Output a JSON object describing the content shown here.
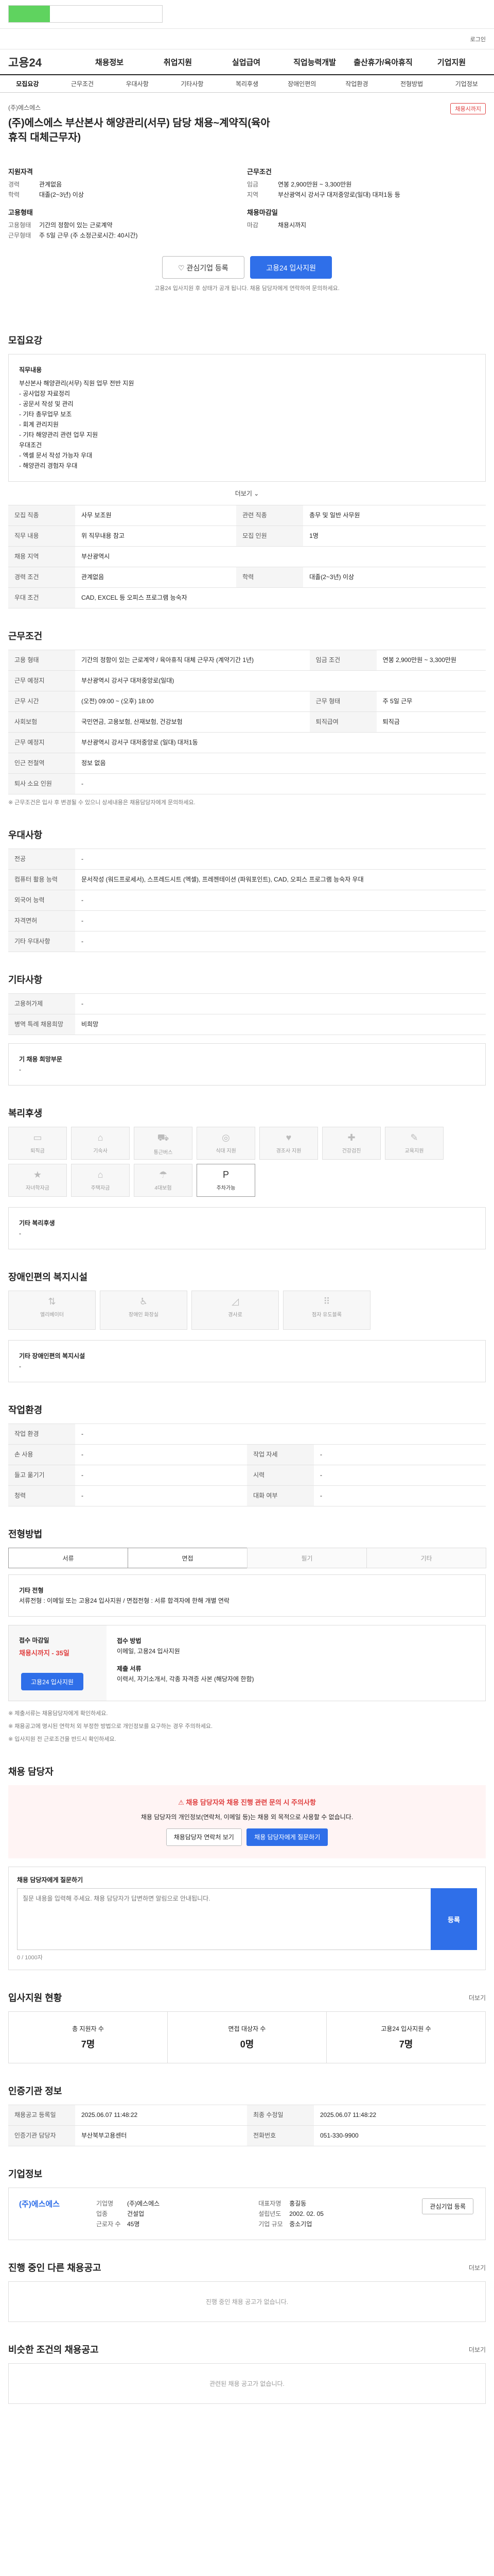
{
  "header": {
    "util": "로그인",
    "logo": "고용24",
    "gnb": [
      "채용정보",
      "취업지원",
      "실업급여",
      "직업능력개발",
      "출산휴가/육아휴직",
      "기업지원"
    ]
  },
  "tabs": [
    "모집요강",
    "근무조건",
    "우대사항",
    "기타사항",
    "복리후생",
    "장애인편의",
    "작업환경",
    "전형방법",
    "기업정보"
  ],
  "job": {
    "badge": "채용시까지",
    "company": "(주)에스에스",
    "title": "(주)에스에스 부산본사 해양관리(서무) 담당 채용~계약직(육아휴직 대체근무자)",
    "summary": {
      "qual_title": "지원자격",
      "qual": [
        [
          "경력",
          "관계없음"
        ],
        [
          "학력",
          "대졸(2~3년) 이상"
        ]
      ],
      "form_title": "고용형태",
      "form": [
        [
          "고용형태",
          "기간의 정함이 있는 근로계약"
        ],
        [
          "근무형태",
          "주 5일 근무 (주 소정근로시간: 40시간)"
        ]
      ],
      "cond_title": "근무조건",
      "cond": [
        [
          "임금",
          "연봉 2,900만원 ~ 3,300만원"
        ],
        [
          "지역",
          "부산광역시 강서구 대저중앙로(일대) 대저1동 등"
        ]
      ],
      "time_title": "채용마감일",
      "time": [
        [
          "마감",
          "채용시까지"
        ]
      ]
    },
    "btn_interest": "관심기업 등록",
    "btn_apply": "고용24 입사지원",
    "apply_note": "고용24 입사지원 후 상태가 공개 됩니다. 채용 담당자에게 연락하여 문의하세요."
  },
  "recruit": {
    "title": "모집요강",
    "duty_title": "직무내용",
    "duties": [
      "부산본사 해양관리(서무) 직원 업무 전반 지원",
      "- 공사업장 자료정리",
      "- 공문서 작성 및 관리",
      "- 기타 총무업무 보조",
      "- 회계 관리지원",
      "- 기타 해양관리 관련 업무 지원",
      "우대조건",
      "- 엑셀 문서 작성 가능자 우대",
      "- 해양관리 경험자 우대"
    ],
    "more": "더보기",
    "rows": [
      [
        "모집 직종",
        "사무 보조원",
        "관련 직종",
        "총무 및 일반 사무원"
      ],
      [
        "직무 내용",
        "위 직무내용 참고",
        "모집 인원",
        "1명"
      ],
      [
        "채용 지역",
        "부산광역시",
        "",
        ""
      ],
      [
        "경력 조건",
        "관계없음",
        "학력",
        "대졸(2~3년) 이상"
      ],
      [
        "우대 조건",
        "CAD, EXCEL 등 오피스 프로그램 능숙자",
        "",
        ""
      ]
    ]
  },
  "work": {
    "title": "근무조건",
    "rows": [
      [
        "고용 형태",
        "기간의 정함이 있는 근로계약 / 육아휴직 대체 근무자 (계약기간 1년)",
        "임금 조건",
        "연봉 2,900만원 ~ 3,300만원"
      ],
      [
        "근무 예정지",
        "부산광역시 강서구 대저중앙로(일대)",
        "",
        ""
      ],
      [
        "근무 시간",
        "(오전) 09:00 ~ (오후) 18:00",
        "근무 형태",
        "주 5일 근무"
      ],
      [
        "사회보험",
        "국민연금, 고용보험, 산재보험, 건강보험",
        "퇴직급여",
        "퇴직금"
      ],
      [
        "근무 예정지",
        "부산광역시 강서구 대저중앙로 (일대) 대저1동",
        "",
        ""
      ],
      [
        "인근 전철역",
        "정보 없음",
        "",
        ""
      ],
      [
        "퇴사 소요 인원",
        "-",
        "",
        ""
      ]
    ],
    "note": "※ 근무조건은 입사 후 변경될 수 있으니 상세내용은 채용담당자에게 문의하세요."
  },
  "prefer": {
    "title": "우대사항",
    "rows": [
      [
        "전공",
        "-",
        "",
        ""
      ],
      [
        "컴퓨터 활용 능력",
        "문서작성 (워드프로세서), 스프레드시트 (엑셀), 프레젠테이션 (파워포인트), CAD, 오피스 프로그램 능숙자 우대",
        "",
        ""
      ],
      [
        "외국어 능력",
        "-",
        "",
        ""
      ],
      [
        "자격면허",
        "-",
        "",
        ""
      ],
      [
        "기타 우대사항",
        "-",
        "",
        ""
      ]
    ]
  },
  "etc": {
    "title": "기타사항",
    "rows": [
      [
        "고용허가제",
        "-",
        "",
        ""
      ],
      [
        "병역 특례 채용희망",
        "비희망",
        "",
        ""
      ]
    ],
    "sub": "기 채용 희망부문",
    "sub_value": "-"
  },
  "welfare": {
    "title": "복리후생",
    "icons": [
      "퇴직금",
      "기숙사",
      "통근버스",
      "식대 지원",
      "경조사 지원",
      "건강검진",
      "교육지원",
      "자녀학자금",
      "주택자금",
      "4대보험",
      "주차가능"
    ],
    "on_index": 10,
    "extra_title": "기타 복리후생",
    "extra_value": "-"
  },
  "disabled": {
    "title": "장애인편의 복지시설",
    "icons": [
      "엘리베이터",
      "장애인 화장실",
      "경사로",
      "점자 유도블록"
    ],
    "extra_title": "기타 장애인편의 복지시설",
    "extra_value": "-"
  },
  "env": {
    "title": "작업환경",
    "rows": [
      [
        "작업 환경",
        "-",
        "",
        ""
      ],
      [
        "손 사용",
        "-",
        "작업 자세",
        "-"
      ],
      [
        "들고 옮기기",
        "-",
        "시력",
        "-"
      ],
      [
        "청력",
        "-",
        "대화 여부",
        "-"
      ]
    ]
  },
  "process": {
    "title": "전형방법",
    "steps": [
      "서류",
      "면접",
      "필기",
      "기타"
    ],
    "on": [
      true,
      true,
      false,
      false
    ],
    "etc_title": "기타 전형",
    "etc_text": "서류전형 : 이메일 또는 고용24 입사지원 / 면접전형 : 서류 합격자에 한해 개별 연락",
    "deadline_label": "접수 마감일",
    "deadline_value": "채용시까지 - 35일",
    "method_label": "접수 방법",
    "method_value": "이메일, 고용24 입사지원",
    "docs_label": "제출 서류",
    "docs_value": "이력서, 자기소개서, 각종 자격증 사본 (해당자에 한함)",
    "apply_btn": "고용24 입사지원",
    "notes": [
      "※ 제출서류는 채용담당자에게 확인하세요.",
      "※ 채용공고에 명시된 연락처 외 부정한 방법으로 개인정보를 요구하는 경우 주의하세요.",
      "※ 입사지원 전 근로조건을 반드시 확인하세요."
    ]
  },
  "contact": {
    "title": "채용 담당자",
    "alert_title": "채용 담당자와 채용 진행 관련 문의 시 주의사항",
    "alert_text": "채용 담당자의 개인정보(연락처, 이메일 등)는 채용 외 목적으로 사용할 수 없습니다.",
    "btn1": "채용담당자 연락처 보기",
    "btn2": "채용 담당자에게 질문하기",
    "q_label": "채용 담당자에게 질문하기",
    "q_placeholder": "질문 내용을 입력해 주세요. 채용 담당자가 답변하면 알림으로 안내됩니다.",
    "q_count": "0 / 1000자",
    "q_send": "등록"
  },
  "stats": {
    "title": "입사지원 현황",
    "more": "더보기",
    "items": [
      [
        "총 지원자 수",
        "7명"
      ],
      [
        "면접 대상자 수",
        "0명"
      ],
      [
        "고용24 입사지원 수",
        "7명"
      ]
    ]
  },
  "meta": {
    "title": "인증기관 정보",
    "rows": [
      [
        "채용공고 등록일",
        "2025.06.07 11:48:22",
        "최종 수정일",
        "2025.06.07 11:48:22"
      ],
      [
        "인증기관 담당자",
        "부산북부고용센터",
        "전화번호",
        "051-330-9900"
      ]
    ]
  },
  "company": {
    "title": "기업정보",
    "name": "(주)에스에스",
    "rows": [
      [
        "기업명",
        "(주)에스에스"
      ],
      [
        "대표자명",
        "홍길동"
      ],
      [
        "업종",
        "건설업"
      ],
      [
        "설립년도",
        "2002. 02. 05"
      ],
      [
        "근로자 수",
        "45명"
      ],
      [
        "기업 규모",
        "중소기업"
      ]
    ],
    "interest_btn": "관심기업 등록"
  },
  "other_jobs": {
    "title": "진행 중인 다른 채용공고",
    "more": "더보기",
    "empty": "진행 중인 채용 공고가 없습니다."
  },
  "similar_jobs": {
    "title": "비슷한 조건의 채용공고",
    "more": "더보기",
    "empty": "관련된 채용 공고가 없습니다."
  }
}
